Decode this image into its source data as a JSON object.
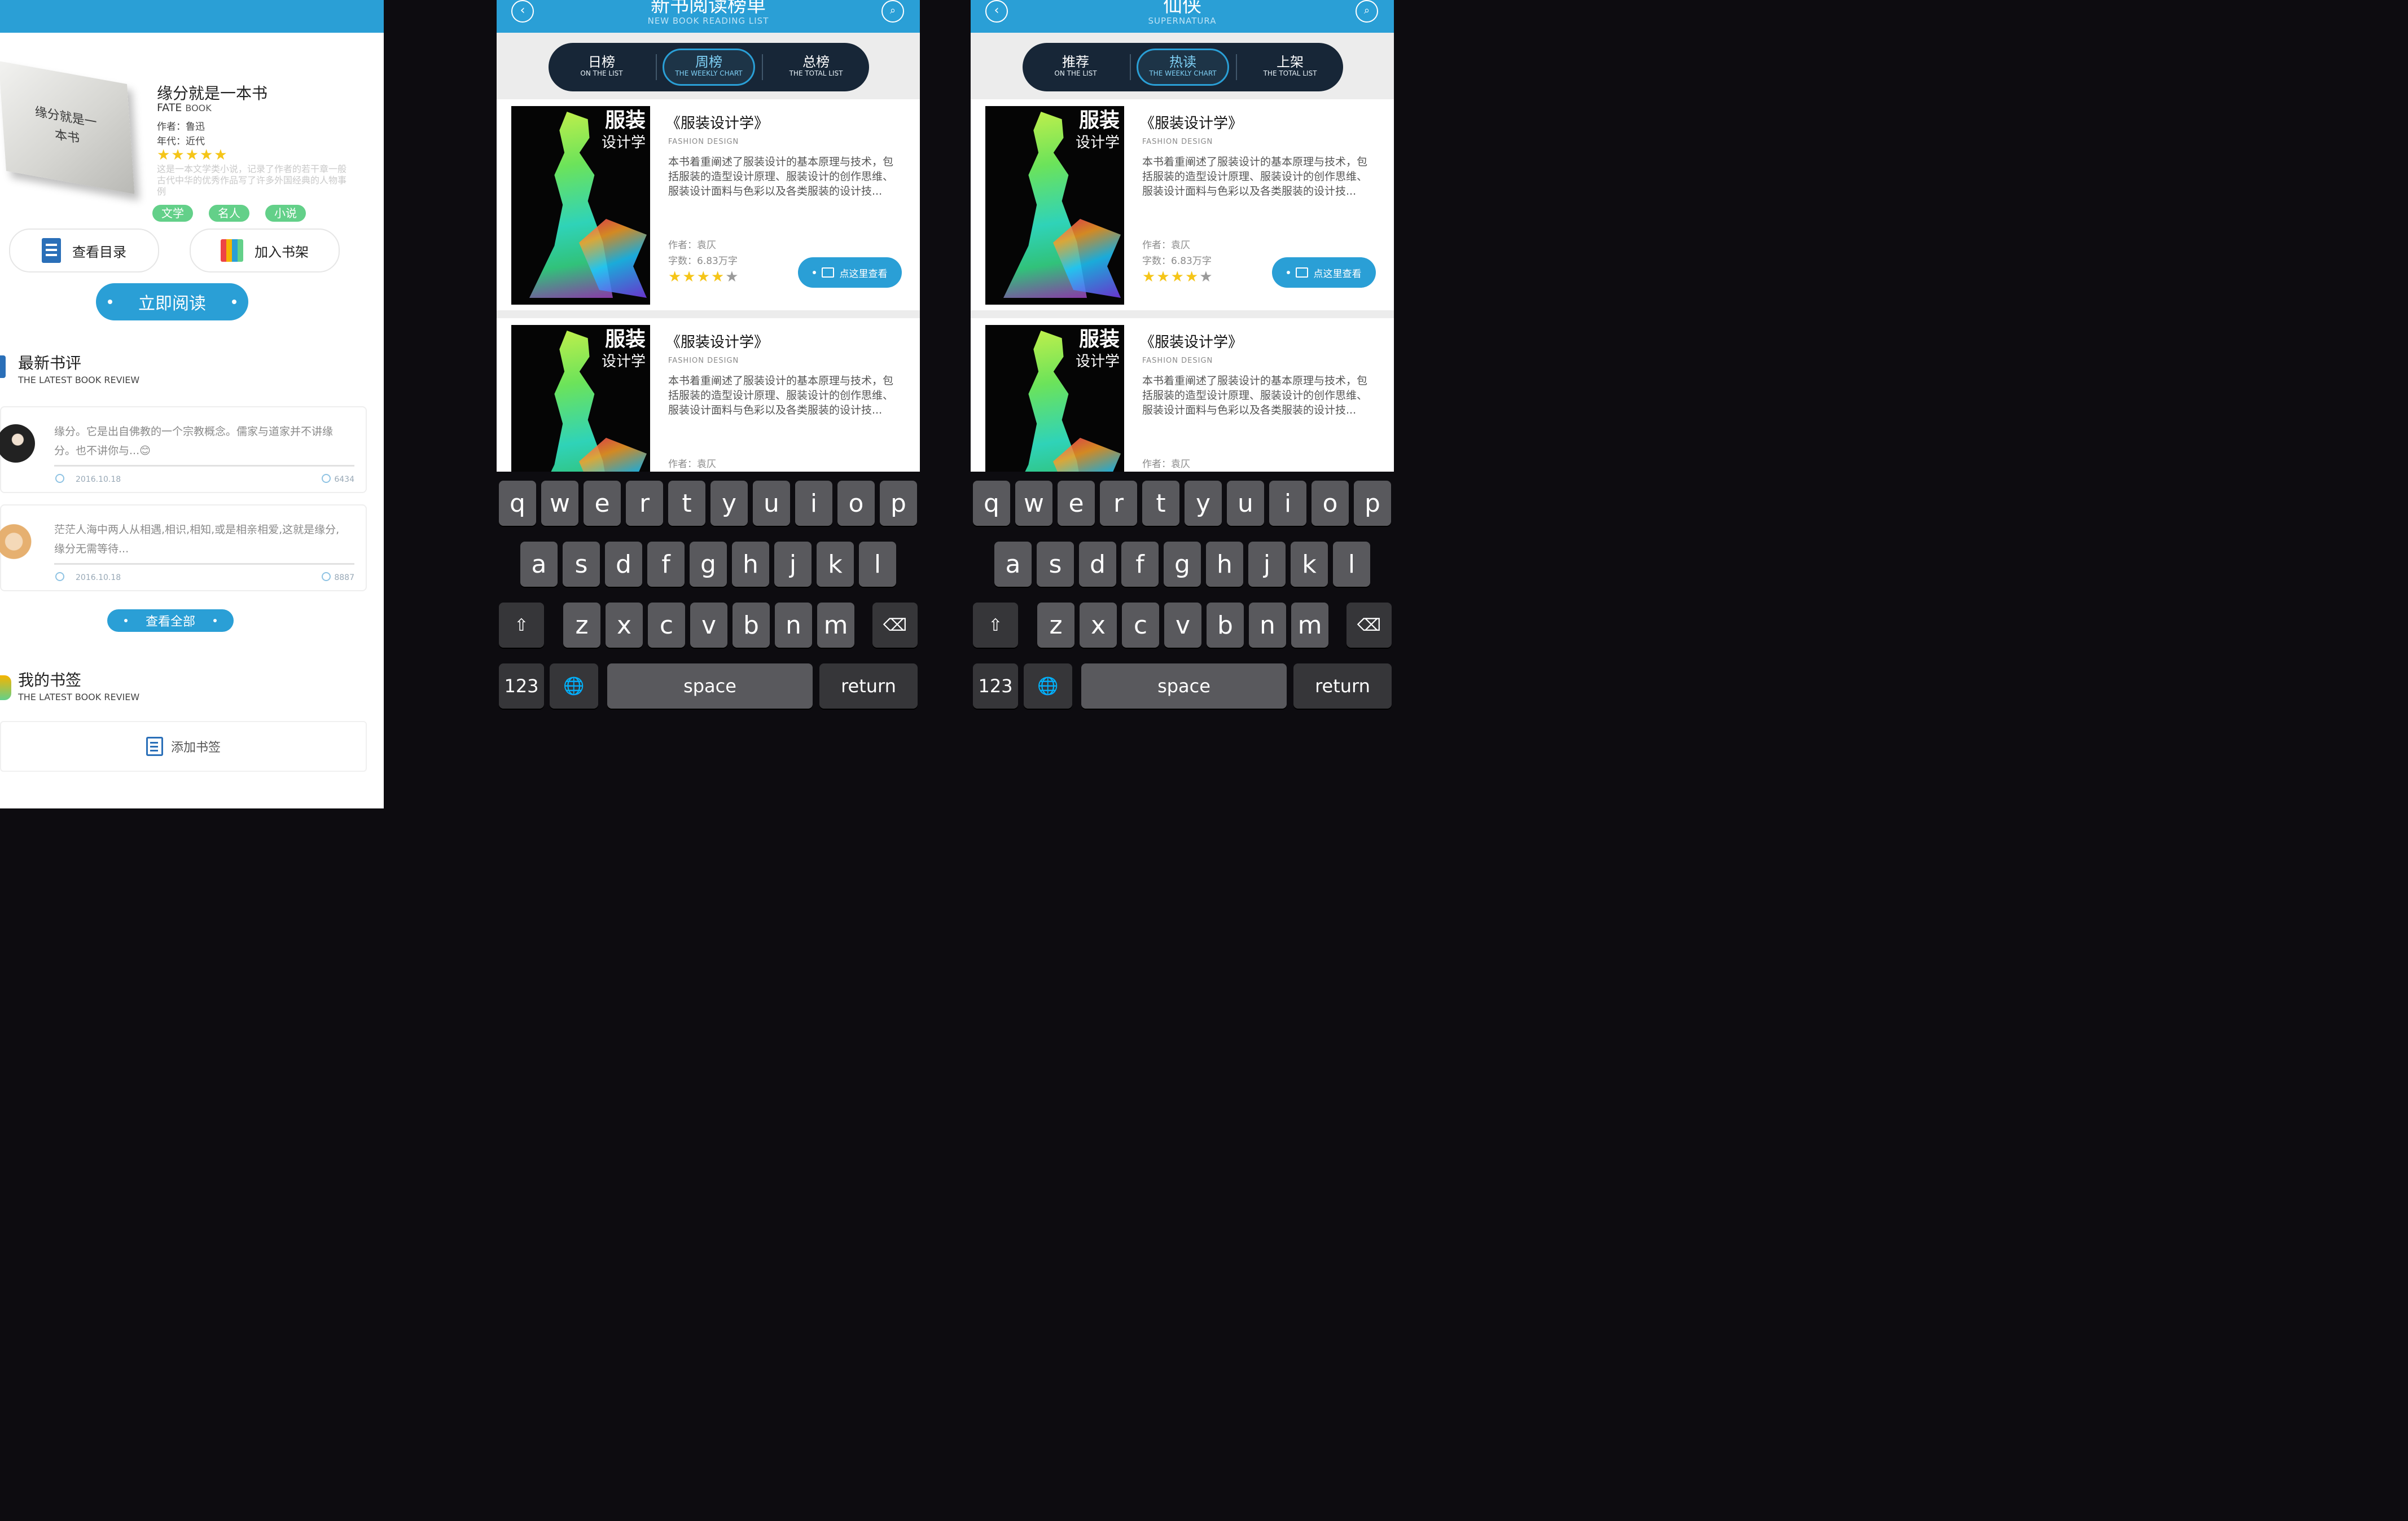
{
  "detail": {
    "cover_text": "缘分就是一本书",
    "title": "缘分就是一本书",
    "subtitle_en_a": "FATE",
    "subtitle_en_b": "BOOK",
    "author": "作者：鲁迅",
    "era": "年代：近代",
    "rating": 5,
    "description": "这是一本文学类小说，记录了作者的若干章一般古代中华的优秀作品写了许多外国经典的人物事例",
    "tags": [
      "文学",
      "名人",
      "小说"
    ],
    "catalog_label": "查看目录",
    "shelf_label": "加入书架",
    "read_label": "立即阅读",
    "reviews_title": "最新书评",
    "reviews_en": "THE LATEST BOOK REVIEW",
    "reviews": [
      {
        "text": "缘分。它是出自佛教的一个宗教概念。儒家与道家并不讲缘分。也不讲你与...😊",
        "date": "2016.10.18",
        "count": "6434"
      },
      {
        "text": "茫茫人海中两人从相遇,相识,相知,或是相亲相爱,这就是缘分,缘分无需等待...",
        "date": "2016.10.18",
        "count": "8887"
      }
    ],
    "view_all_label": "查看全部",
    "bookmark_title": "我的书签",
    "bookmark_en": "THE LATEST BOOK REVIEW",
    "add_bookmark_label": "添加书签"
  },
  "ranking": {
    "back_icon": "back-icon",
    "search_icon": "search-icon",
    "title": "新书阅读榜单",
    "subtitle": "NEW BOOK READING LIST",
    "tabs": [
      {
        "cn": "日榜",
        "en": "ON THE LIST"
      },
      {
        "cn": "周榜",
        "en": "THE WEEKLY CHART"
      },
      {
        "cn": "总榜",
        "en": "THE TOTAL LIST"
      }
    ]
  },
  "xianxia": {
    "title": "仙侠",
    "subtitle": "SUPERNATURA",
    "tabs": [
      {
        "cn": "推荐",
        "en": "ON THE LIST"
      },
      {
        "cn": "热读",
        "en": "THE WEEKLY CHART"
      },
      {
        "cn": "上架",
        "en": "THE TOTAL LIST"
      }
    ]
  },
  "book_card": {
    "cover_title": "服装",
    "cover_title2": "设计学",
    "title": "《服装设计学》",
    "title_en": "FASHION DESIGN",
    "description": "本书着重阐述了服装设计的基本原理与技术，包括服装的造型设计原理、服装设计的创作思维、服装设计面料与色彩以及各类服装的设计技...",
    "author": "作者：袁仄",
    "words": "字数：6.83万字",
    "rating": 4,
    "rating_max": 5,
    "look_label": "点这里查看"
  },
  "keyboard": {
    "row1": [
      "q",
      "w",
      "e",
      "r",
      "t",
      "y",
      "u",
      "i",
      "o",
      "p"
    ],
    "row2": [
      "a",
      "s",
      "d",
      "f",
      "g",
      "h",
      "j",
      "k",
      "l"
    ],
    "row3": [
      "z",
      "x",
      "c",
      "v",
      "b",
      "n",
      "m"
    ],
    "shift_icon": "shift-icon",
    "delete_icon": "delete-icon",
    "globe_icon": "globe-icon",
    "numbers_label": "123",
    "space_label": "space",
    "return_label": "return"
  },
  "colors": {
    "accent": "#2a9fd6",
    "tag_green": "#63d089",
    "star": "#f5c518",
    "segment_bg": "#172637",
    "keyboard_bg": "#0d0c10",
    "key": "#59595d"
  }
}
